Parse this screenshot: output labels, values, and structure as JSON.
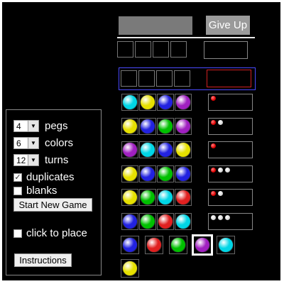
{
  "top": {
    "give_up_label": "Give Up"
  },
  "controls": {
    "pegs": {
      "value": "4",
      "label": "pegs"
    },
    "colors": {
      "value": "6",
      "label": "colors"
    },
    "turns": {
      "value": "12",
      "label": "turns"
    },
    "duplicates": {
      "label": "duplicates",
      "checked": true
    },
    "blanks": {
      "label": "blanks",
      "checked": false
    },
    "start_label": "Start New Game",
    "click_to_place": {
      "label": "click to place",
      "checked": false
    },
    "instructions_label": "Instructions"
  },
  "peg_colors": {
    "cyan": "#00d6e6",
    "yellow": "#e6e000",
    "blue": "#2222e0",
    "purple": "#a020c0",
    "green": "#00c000",
    "red": "#e02020"
  },
  "guesses": [
    {
      "pegs": [
        "cyan",
        "yellow",
        "blue",
        "purple"
      ],
      "feedback": [
        "red"
      ]
    },
    {
      "pegs": [
        "yellow",
        "blue",
        "green",
        "purple"
      ],
      "feedback": [
        "red",
        "white"
      ]
    },
    {
      "pegs": [
        "purple",
        "cyan",
        "blue",
        "yellow"
      ],
      "feedback": [
        "red"
      ]
    },
    {
      "pegs": [
        "yellow",
        "blue",
        "green",
        "blue"
      ],
      "feedback": [
        "red",
        "white",
        "white"
      ]
    },
    {
      "pegs": [
        "yellow",
        "green",
        "cyan",
        "red"
      ],
      "feedback": [
        "red",
        "white"
      ]
    },
    {
      "pegs": [
        "blue",
        "green",
        "red",
        "cyan"
      ],
      "feedback": [
        "white",
        "white",
        "white"
      ]
    }
  ],
  "palette": [
    "blue",
    "red",
    "green",
    "purple",
    "cyan",
    "yellow"
  ],
  "palette_selected": "purple"
}
